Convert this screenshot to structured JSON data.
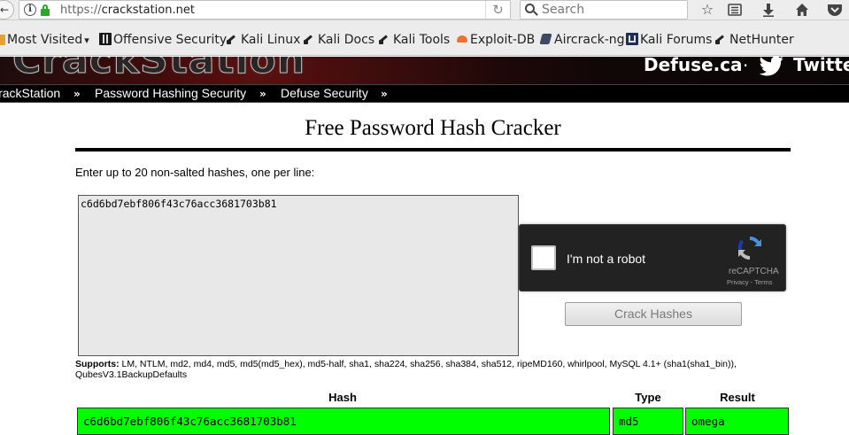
{
  "browser": {
    "url_protocol": "https://",
    "url_host": "crackstation.net",
    "search_placeholder": "Search",
    "back_glyph": "←",
    "reload_glyph": "↻",
    "info_glyph": "i"
  },
  "bookmarks": [
    {
      "label": "Most Visited",
      "icon": "rss-icon"
    },
    {
      "label": "Offensive Security",
      "icon": "offsec-icon"
    },
    {
      "label": "Kali Linux",
      "icon": "kali-dragon-icon"
    },
    {
      "label": "Kali Docs",
      "icon": "kali-dragon-icon"
    },
    {
      "label": "Kali Tools",
      "icon": "kali-dragon-icon"
    },
    {
      "label": "Exploit-DB",
      "icon": "exploitdb-icon"
    },
    {
      "label": "Aircrack-ng",
      "icon": "aircrack-icon"
    },
    {
      "label": "Kali Forums",
      "icon": "kali-forums-icon"
    },
    {
      "label": "NetHunter",
      "icon": "kali-dragon-icon"
    }
  ],
  "banner": {
    "logo_text": "CrackStation",
    "defuse": "Defuse.ca",
    "separator": "·",
    "twitter": "Twitter"
  },
  "sitenav": [
    {
      "label": "CrackStation"
    },
    {
      "label": "Password Hashing Security"
    },
    {
      "label": "Defuse Security"
    }
  ],
  "main": {
    "title": "Free Password Hash Cracker",
    "instructions": "Enter up to 20 non-salted hashes, one per line:",
    "hash_input_value": "c6d6bd7ebf806f43c76acc3681703b81",
    "captcha_label": "I'm not a robot",
    "captcha_brand": "reCAPTCHA",
    "captcha_privacy": "Privacy",
    "captcha_sep": " - ",
    "captcha_terms": "Terms",
    "crack_button": "Crack Hashes",
    "supports_label": "Supports:",
    "supports_text": " LM, NTLM, md2, md4, md5, md5(md5_hex), md5-half, sha1, sha224, sha256, sha384, sha512, ripeMD160, whirlpool, MySQL 4.1+ (sha1(sha1_bin)), QubesV3.1BackupDefaults"
  },
  "results": {
    "columns": [
      "Hash",
      "Type",
      "Result"
    ],
    "rows": [
      {
        "hash": "c6d6bd7ebf806f43c76acc3681703b81",
        "type": "md5",
        "result": "omega",
        "status_color": "#00ff00"
      }
    ]
  }
}
